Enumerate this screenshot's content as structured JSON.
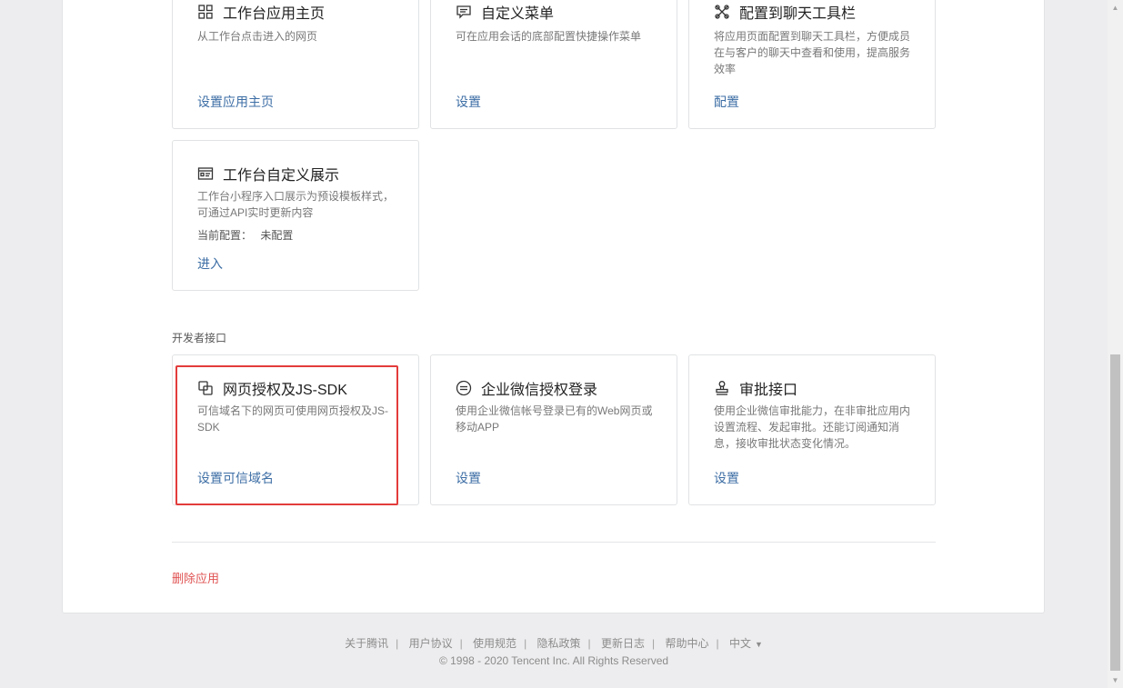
{
  "cards_top": [
    {
      "title": "工作台应用主页",
      "icon": "grid-icon",
      "desc": "从工作台点击进入的网页",
      "link": "设置应用主页"
    },
    {
      "title": "自定义菜单",
      "icon": "menu-message-icon",
      "desc": "可在应用会话的底部配置快捷操作菜单",
      "link": "设置"
    },
    {
      "title": "配置到聊天工具栏",
      "icon": "tools-cross-icon",
      "desc": "将应用页面配置到聊天工具栏，方便成员在与客户的聊天中查看和使用，提高服务效率",
      "link": "配置"
    }
  ],
  "card_workbench": {
    "title": "工作台自定义展示",
    "icon": "display-card-icon",
    "desc": "工作台小程序入口展示为预设模板样式，可通过API实时更新内容",
    "meta_label": "当前配置：",
    "meta_value": "未配置",
    "link": "进入"
  },
  "section_dev": "开发者接口",
  "cards_dev": [
    {
      "title": "网页授权及JS-SDK",
      "icon": "copy-windows-icon",
      "desc": "可信域名下的网页可使用网页授权及JS-SDK",
      "link": "设置可信域名"
    },
    {
      "title": "企业微信授权登录",
      "icon": "login-circle-icon",
      "desc": "使用企业微信帐号登录已有的Web网页或移动APP",
      "link": "设置"
    },
    {
      "title": "审批接口",
      "icon": "stamp-icon",
      "desc": "使用企业微信审批能力，在非审批应用内设置流程、发起审批。还能订阅通知消息，接收审批状态变化情况。",
      "link": "设置"
    }
  ],
  "delete_app": "删除应用",
  "footer": {
    "links": [
      "关于腾讯",
      "用户协议",
      "使用规范",
      "隐私政策",
      "更新日志",
      "帮助中心"
    ],
    "lang": "中文",
    "copyright": "© 1998 - 2020 Tencent Inc. All Rights Reserved"
  },
  "colors": {
    "link": "#3d6ea5",
    "danger": "#e05353",
    "highlight": "#e33b3b"
  }
}
